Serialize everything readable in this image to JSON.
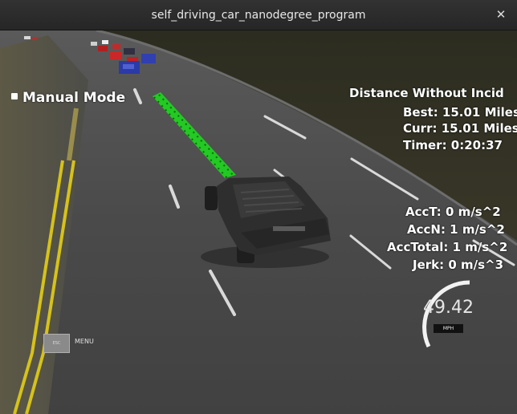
{
  "window": {
    "title": "self_driving_car_nanodegree_program",
    "close_glyph": "✕"
  },
  "hud": {
    "mode_label": "Manual Mode",
    "distance_title": "Distance Without Incid",
    "best": "Best: 15.01 Miles",
    "curr": "Curr: 15.01 Miles",
    "timer": "Timer: 0:20:37",
    "acc_t": "AccT: 0 m/s^2",
    "acc_n": "AccN: 1 m/s^2",
    "acc_total": "AccTotal: 1 m/s^2",
    "jerk": "Jerk: 0 m/s^3"
  },
  "speedometer": {
    "value": "49.42",
    "unit": "MPH",
    "level": 0.49
  },
  "controls": {
    "esc_label": "ESC",
    "menu_label": "MENU"
  },
  "colors": {
    "path": "#1fd61f",
    "lane_yellow": "#d6c21a",
    "lane_white": "#d9d9d9",
    "road": "#4a4a4a",
    "grass": "#3a3a2c"
  }
}
